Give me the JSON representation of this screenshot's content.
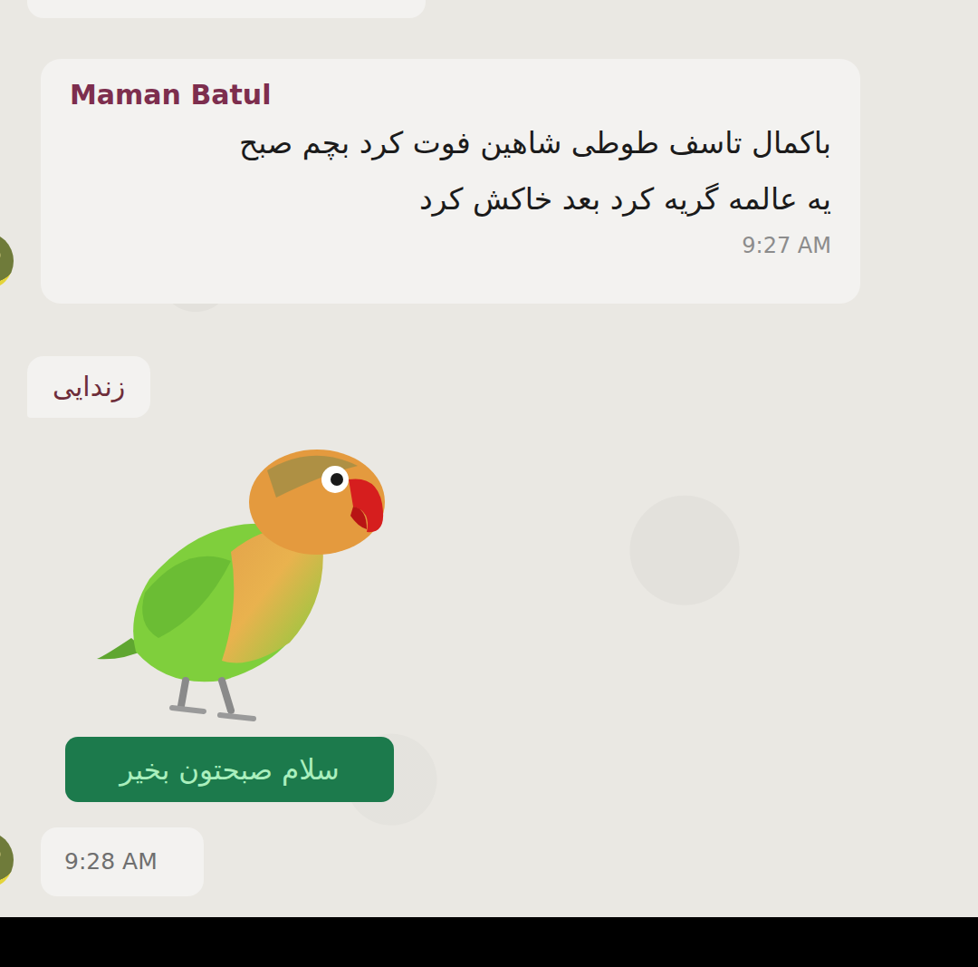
{
  "chat": {
    "messages": [
      {
        "kind": "text",
        "sender": "Maman Batul",
        "lines": [
          "باکمال تاسف طوطی شاهین فوت کرد بچم صبح",
          "یه عالمه گریه کرد بعد خاکش کرد"
        ],
        "time": "9:27 AM"
      },
      {
        "kind": "short",
        "text": "زندایی"
      },
      {
        "kind": "sticker",
        "caption": "سلام صبحتون بخیر"
      },
      {
        "kind": "time",
        "time": "9:28 AM"
      }
    ]
  }
}
